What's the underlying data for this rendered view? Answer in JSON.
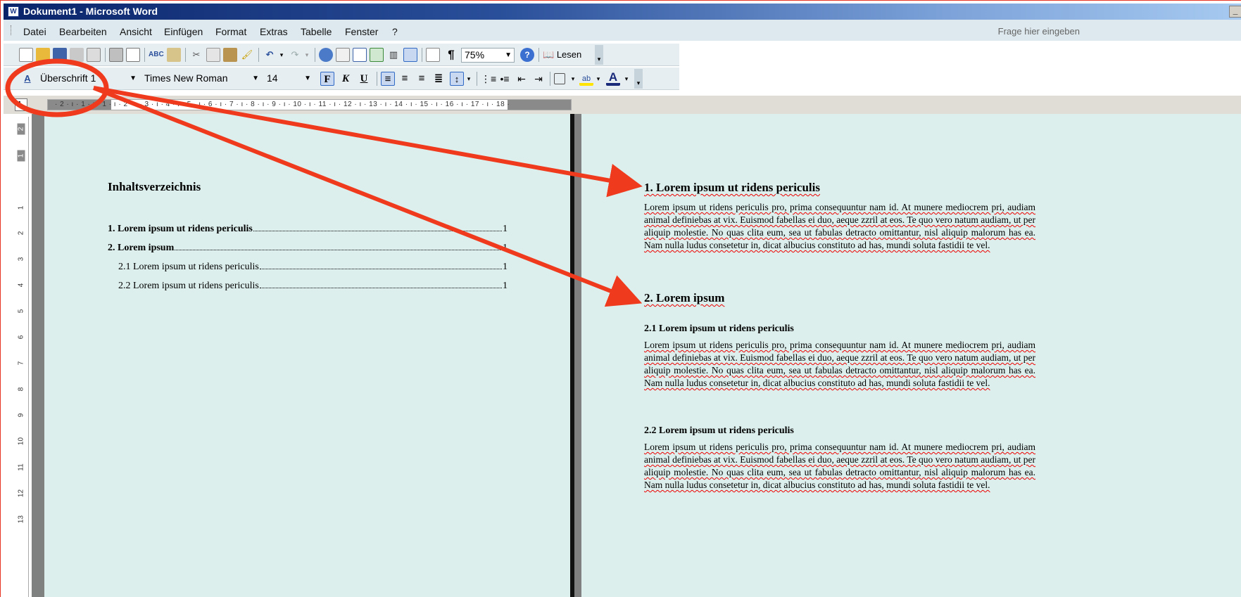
{
  "window": {
    "title": "Dokument1 - Microsoft Word"
  },
  "menu": {
    "items": [
      {
        "label": "Datei"
      },
      {
        "label": "Bearbeiten"
      },
      {
        "label": "Ansicht"
      },
      {
        "label": "Einfügen"
      },
      {
        "label": "Format"
      },
      {
        "label": "Extras"
      },
      {
        "label": "Tabelle"
      },
      {
        "label": "Fenster"
      },
      {
        "label": "?"
      }
    ],
    "help_placeholder": "Frage hier eingeben"
  },
  "standard_toolbar": {
    "zoom": "75%",
    "read_label": "Lesen",
    "icons": [
      "new-document-icon",
      "open-icon",
      "save-icon",
      "permission-icon",
      "email-icon",
      "print-icon",
      "print-preview-icon",
      "spelling-icon",
      "research-icon",
      "cut-icon",
      "copy-icon",
      "paste-icon",
      "format-painter-icon",
      "undo-icon",
      "redo-icon",
      "hyperlink-icon",
      "tables-borders-icon",
      "insert-table-icon",
      "insert-excel-icon",
      "columns-icon",
      "drawing-icon",
      "document-map-icon",
      "show-formatting-icon",
      "help-icon",
      "read-icon"
    ]
  },
  "formatting_toolbar": {
    "style": "Überschrift 1",
    "font": "Times New Roman",
    "size": "14",
    "bold_label": "F",
    "italic_label": "K",
    "underline_label": "U"
  },
  "ruler": {
    "corner_label": "L",
    "marks": "· 2 · ı · 1 · ı · 1 · ı · 2 · ı · 3 · ı · 4 · ı · 5 · ı · 6 · ı · 7 · ı · 8 · ı · 9 · ı · 10 · ı · 11 · ı · 12 · ı · 13 · ı · 14 · ı · 15 · ı · 16 · ı · 17 · ı · 18 ·",
    "vertical_marks": [
      "2",
      "1",
      "1",
      "2",
      "3",
      "4",
      "5",
      "6",
      "7",
      "8",
      "9",
      "10",
      "11",
      "12",
      "13"
    ]
  },
  "left_page": {
    "toc_title": "Inhaltsverzeichnis",
    "toc": [
      {
        "label": "1. Lorem ipsum ut ridens periculis",
        "page": "1",
        "level": 1
      },
      {
        "label": "2. Lorem ipsum",
        "page": "1",
        "level": 1
      },
      {
        "label": "2.1 Lorem ipsum ut ridens periculis",
        "page": "1",
        "level": 2
      },
      {
        "label": "2.2 Lorem ipsum ut ridens periculis",
        "page": "1",
        "level": 2
      }
    ]
  },
  "right_page": {
    "heading1": "1. Lorem ipsum ut ridens periculis",
    "heading2": "2. Lorem ipsum",
    "sub1": "2.1 Lorem ipsum ut ridens periculis",
    "sub2": "2.2 Lorem ipsum ut ridens periculis",
    "paragraph": "Lorem ipsum ut ridens periculis pro, prima consequuntur nam id. At munere mediocrem pri, audiam animal definiebas at vix. Euismod fabellas ei duo, aeque zzril at eos. Te quo vero natum audiam, ut per aliquip molestie. No quas clita eum, sea ut fabulas detracto omittantur, nisl aliquip malorum has ea. Nam nulla ludus consetetur in, dicat albucius constituto ad has, mundi soluta fastidii te vel."
  },
  "colors": {
    "annotation": "#f03a1e",
    "titlebar_start": "#0a246a",
    "document_bg": "#dcefec"
  }
}
